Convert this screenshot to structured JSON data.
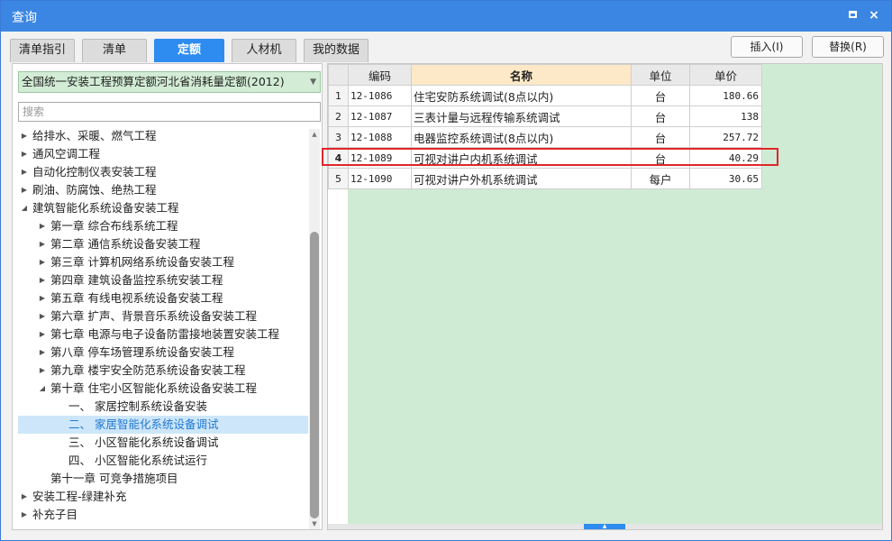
{
  "window": {
    "title": "查询",
    "restore_icon": "restore-icon",
    "close_icon": "close-icon",
    "close_label": "×"
  },
  "tabs": [
    {
      "label": "清单指引",
      "active": false
    },
    {
      "label": "清单",
      "active": false
    },
    {
      "label": "定额",
      "active": true
    },
    {
      "label": "人材机",
      "active": false
    },
    {
      "label": "我的数据",
      "active": false
    }
  ],
  "buttons": {
    "insert": "插入(I)",
    "replace": "替换(R)"
  },
  "quota_library": {
    "selected": "全国统一安装工程预算定额河北省消耗量定额(2012)"
  },
  "search": {
    "placeholder": "搜索",
    "value": ""
  },
  "tree": [
    {
      "label": "给排水、采暖、燃气工程",
      "level": 0,
      "state": "collapsed"
    },
    {
      "label": "通风空调工程",
      "level": 0,
      "state": "collapsed"
    },
    {
      "label": "自动化控制仪表安装工程",
      "level": 0,
      "state": "collapsed"
    },
    {
      "label": "刷油、防腐蚀、绝热工程",
      "level": 0,
      "state": "collapsed"
    },
    {
      "label": "建筑智能化系统设备安装工程",
      "level": 0,
      "state": "expanded"
    },
    {
      "label": "第一章 综合布线系统工程",
      "level": 1,
      "state": "collapsed"
    },
    {
      "label": "第二章 通信系统设备安装工程",
      "level": 1,
      "state": "collapsed"
    },
    {
      "label": "第三章 计算机网络系统设备安装工程",
      "level": 1,
      "state": "collapsed"
    },
    {
      "label": "第四章 建筑设备监控系统安装工程",
      "level": 1,
      "state": "collapsed"
    },
    {
      "label": "第五章 有线电视系统设备安装工程",
      "level": 1,
      "state": "collapsed"
    },
    {
      "label": "第六章 扩声、背景音乐系统设备安装工程",
      "level": 1,
      "state": "collapsed"
    },
    {
      "label": "第七章 电源与电子设备防雷接地装置安装工程",
      "level": 1,
      "state": "collapsed"
    },
    {
      "label": "第八章 停车场管理系统设备安装工程",
      "level": 1,
      "state": "collapsed"
    },
    {
      "label": "第九章 楼宇安全防范系统设备安装工程",
      "level": 1,
      "state": "collapsed"
    },
    {
      "label": "第十章 住宅小区智能化系统设备安装工程",
      "level": 1,
      "state": "expanded"
    },
    {
      "label": "一、 家居控制系统设备安装",
      "level": 2,
      "state": "leaf"
    },
    {
      "label": "二、 家居智能化系统设备调试",
      "level": 2,
      "state": "leaf",
      "selected": true
    },
    {
      "label": "三、 小区智能化系统设备调试",
      "level": 2,
      "state": "leaf"
    },
    {
      "label": "四、 小区智能化系统试运行",
      "level": 2,
      "state": "leaf"
    },
    {
      "label": "第十一章 可竞争措施项目",
      "level": 1,
      "state": "leaf"
    },
    {
      "label": "安装工程-绿建补充",
      "level": 0,
      "state": "collapsed"
    },
    {
      "label": "补充子目",
      "level": 0,
      "state": "collapsed"
    }
  ],
  "grid": {
    "headers": {
      "code": "编码",
      "name": "名称",
      "unit": "单位",
      "price": "单价"
    },
    "rows": [
      {
        "idx": "1",
        "code": "12-1086",
        "name": "住宅安防系统调试(8点以内)",
        "unit": "台",
        "price": "180.66"
      },
      {
        "idx": "2",
        "code": "12-1087",
        "name": "三表计量与远程传输系统调试",
        "unit": "台",
        "price": "138"
      },
      {
        "idx": "3",
        "code": "12-1088",
        "name": "电器监控系统调试(8点以内)",
        "unit": "台",
        "price": "257.72"
      },
      {
        "idx": "4",
        "code": "12-1089",
        "name": "可视对讲户内机系统调试",
        "unit": "台",
        "price": "40.29",
        "selected": true
      },
      {
        "idx": "5",
        "code": "12-1090",
        "name": "可视对讲户外机系统调试",
        "unit": "每户",
        "price": "30.65"
      }
    ]
  },
  "splitter_glyph": "▲"
}
